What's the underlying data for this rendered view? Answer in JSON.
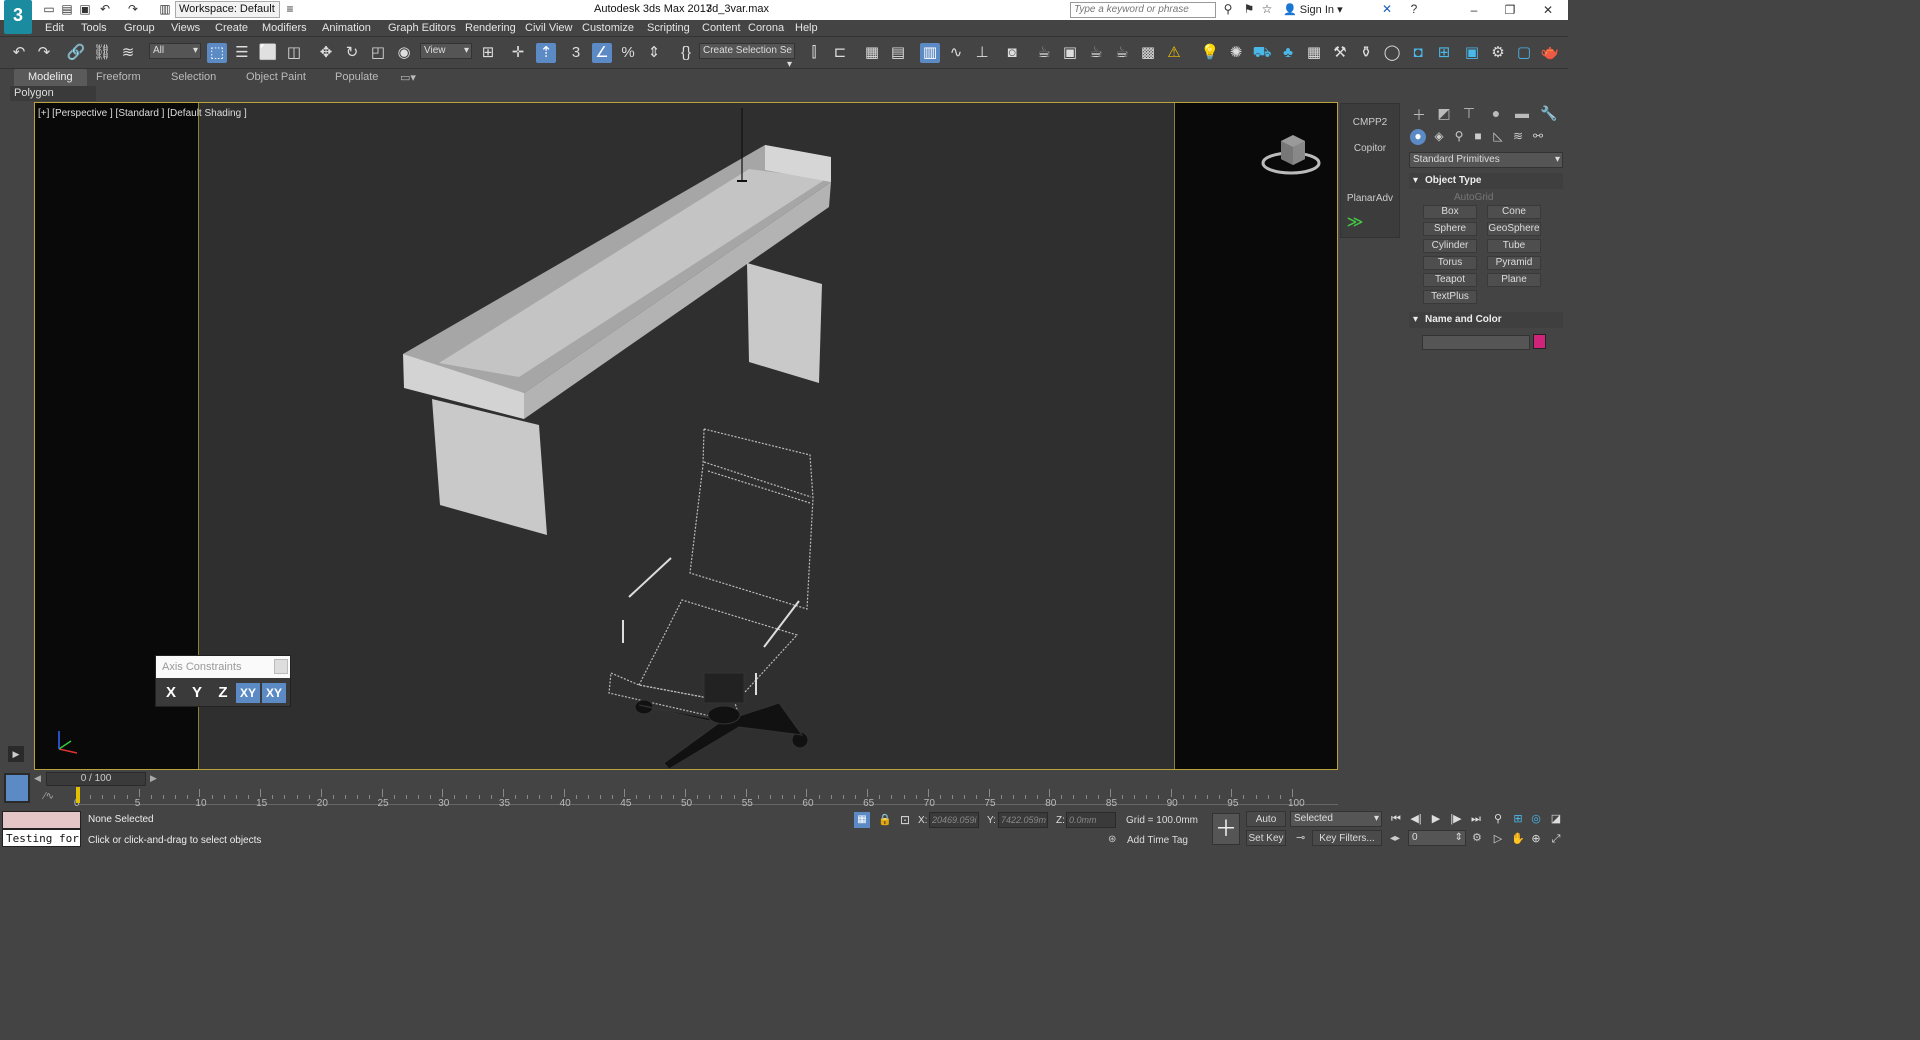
{
  "titlebar": {
    "workspace": "Workspace: Default",
    "app_title": "Autodesk 3ds Max 2017",
    "file_name": "3d_3var.max",
    "search_placeholder": "Type a keyword or phrase",
    "sign_in": "Sign In",
    "logo_text": "3"
  },
  "menubar": [
    "Edit",
    "Tools",
    "Group",
    "Views",
    "Create",
    "Modifiers",
    "Animation",
    "Graph Editors",
    "Rendering",
    "Civil View",
    "Customize",
    "Scripting",
    "Content",
    "Corona",
    "Help"
  ],
  "toolbar": {
    "selection_filter": "All",
    "ref_coord": "View",
    "named_selection": "Create Selection Se"
  },
  "ribbon": {
    "tabs": [
      "Modeling",
      "Freeform",
      "Selection",
      "Object Paint",
      "Populate"
    ],
    "active_tab": "Modeling",
    "panel_label": "Polygon Modeling"
  },
  "viewport": {
    "label": "[+] [Perspective ] [Standard ] [Default Shading ]"
  },
  "axis_constraints": {
    "title": "Axis Constraints",
    "buttons": [
      "X",
      "Y",
      "Z",
      "XY",
      "XY"
    ]
  },
  "right_strip": {
    "items": [
      "CMPP2",
      "Copitor",
      "PlanarAdv"
    ]
  },
  "command_panel": {
    "dropdown": "Standard Primitives",
    "object_type_title": "Object Type",
    "autogrid": "AutoGrid",
    "primitives": [
      "Box",
      "Cone",
      "Sphere",
      "GeoSphere",
      "Cylinder",
      "Tube",
      "Torus",
      "Pyramid",
      "Teapot",
      "Plane",
      "TextPlus"
    ],
    "name_color_title": "Name and Color",
    "object_color": "#d0237a"
  },
  "timeline": {
    "frame_display": "0 / 100",
    "ticks": [
      "0",
      "5",
      "10",
      "15",
      "20",
      "25",
      "30",
      "35",
      "40",
      "45",
      "50",
      "55",
      "60",
      "65",
      "70",
      "75",
      "80",
      "85",
      "90",
      "95",
      "100"
    ]
  },
  "status": {
    "selection": "None Selected",
    "prompt": "Click or click-and-drag to select objects",
    "listener_text": "Testing for ;",
    "x_label": "X:",
    "x_value": "20469.059i",
    "y_label": "Y:",
    "y_value": "7422.059m",
    "z_label": "Z:",
    "z_value": "0.0mm",
    "grid": "Grid = 100.0mm",
    "add_time_tag": "Add Time Tag",
    "auto_key": "Auto Key",
    "set_key": "Set Key",
    "key_mode": "Selected",
    "key_filters": "Key Filters...",
    "current_frame": "0"
  }
}
